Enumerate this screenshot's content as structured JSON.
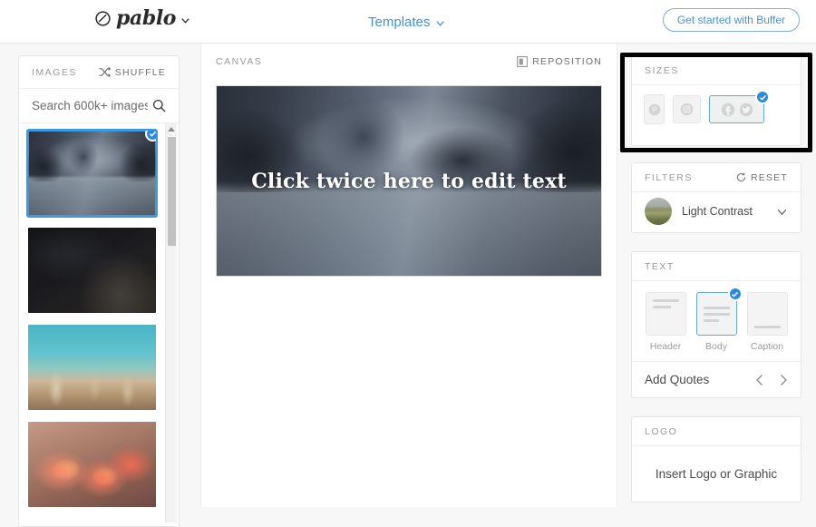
{
  "header": {
    "logo_text": "pablo",
    "logo_icon": "circle-slash-icon",
    "logo_chevron": "chevron-down-icon",
    "templates_label": "Templates",
    "templates_chevron": "chevron-down-icon",
    "cta_label": "Get started with Buffer",
    "accent_blue": "#4a90d6"
  },
  "images_panel": {
    "title": "IMAGES",
    "shuffle_label": "SHUFFLE",
    "shuffle_icon": "shuffle-icon",
    "search_placeholder": "Search 600k+ images",
    "search_value": "",
    "search_icon": "search-icon",
    "thumbnails": [
      {
        "name": "mountain-lake-reflection",
        "selected": true
      },
      {
        "name": "starry-night-sky",
        "selected": false
      },
      {
        "name": "teal-sky-grasses",
        "selected": false
      },
      {
        "name": "orange-lilies",
        "selected": false
      }
    ],
    "scrollbar": {
      "up_arrow_icon": "caret-up-icon"
    }
  },
  "canvas": {
    "title": "CANVAS",
    "reposition_label": "REPOSITION",
    "reposition_icon": "reposition-icon",
    "overlay_text": "Click twice here to edit text",
    "image_name": "mountain-lake-reflection"
  },
  "sizes": {
    "title": "SIZES",
    "options": [
      {
        "name": "pinterest",
        "icon": "pinterest-icon",
        "selected": false
      },
      {
        "name": "instagram",
        "icon": "instagram-icon",
        "selected": false
      },
      {
        "name": "facebook-twitter",
        "icons": [
          "facebook-icon",
          "twitter-icon"
        ],
        "selected": true
      }
    ],
    "selected_check_icon": "check-icon",
    "highlight_color": "#000000",
    "selected_border_color": "#64a8dd"
  },
  "filters": {
    "title": "FILTERS",
    "reset_label": "RESET",
    "reset_icon": "reset-circle-icon",
    "current": "Light Contrast",
    "chevron": "chevron-down-icon",
    "thumbnail_name": "landscape-filter-preview"
  },
  "text": {
    "title": "TEXT",
    "options": [
      {
        "label": "Header",
        "selected": false
      },
      {
        "label": "Body",
        "selected": true
      },
      {
        "label": "Caption",
        "selected": false
      }
    ],
    "check_icon": "check-icon",
    "quotes_label": "Add Quotes",
    "prev_icon": "chevron-left-icon",
    "next_icon": "chevron-right-icon"
  },
  "logo": {
    "title": "LOGO",
    "action_label": "Insert Logo or Graphic"
  }
}
